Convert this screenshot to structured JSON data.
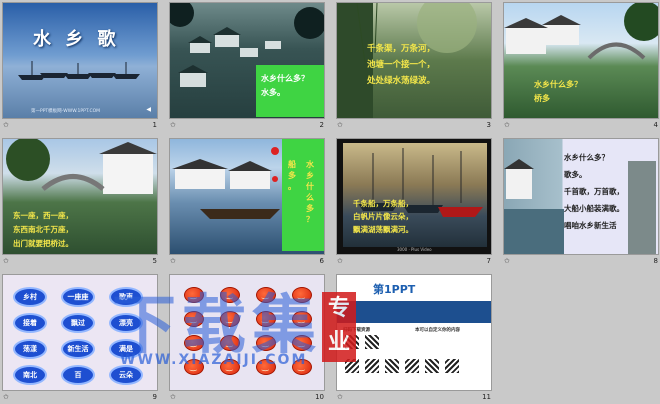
{
  "slides": [
    {
      "num": "1",
      "title": "水 乡 歌",
      "footer": "第一PPT模板网-WWW.1PPT.COM"
    },
    {
      "num": "2",
      "lines": [
        "水乡什么多？",
        "水多。"
      ]
    },
    {
      "num": "3",
      "lines": [
        "千条渠，万条河，",
        "池塘一个接一个，",
        "处处绿水荡绿波。"
      ]
    },
    {
      "num": "4",
      "lines": [
        "水乡什么多？",
        "桥多"
      ]
    },
    {
      "num": "5",
      "lines": [
        "东一座，西一座，",
        "东西南北千万座，",
        "出门就要把桥过。"
      ]
    },
    {
      "num": "6",
      "col_a": "水乡什么多？",
      "col_b": "船多。"
    },
    {
      "num": "7",
      "lines": [
        "千条船，万条船，",
        "白帆片片像云朵，",
        "飘满湖荡飘满河。"
      ],
      "caption": "3000 · Plus Video"
    },
    {
      "num": "8",
      "lines": [
        "水乡什么多？",
        "歌多。",
        "千首歌，万首歌，",
        "大船小船装满歌。",
        "唱咱水乡新生活"
      ]
    },
    {
      "num": "9",
      "words": [
        "乡村",
        "一座座",
        "歌声",
        "接着",
        "飘过",
        "漂亮",
        "荡漾",
        "新生活",
        "满是",
        "南北",
        "百",
        "云朵"
      ]
    },
    {
      "num": "10"
    },
    {
      "num": "11",
      "brand": "第1PPT",
      "heading": "扫码下载资源",
      "right_heading": "本可以自定义你的内容"
    }
  ],
  "watermark": {
    "big": "下载集",
    "side": "专业",
    "url": "WWW.XIAZAIJI.COM"
  },
  "colors": {
    "accent_green": "#3fd443",
    "bubble_blue": "#1e4fd1",
    "pumpkin": "#e2421a",
    "watermark": "#2a5fd8",
    "badge_red": "#d21a1a"
  }
}
